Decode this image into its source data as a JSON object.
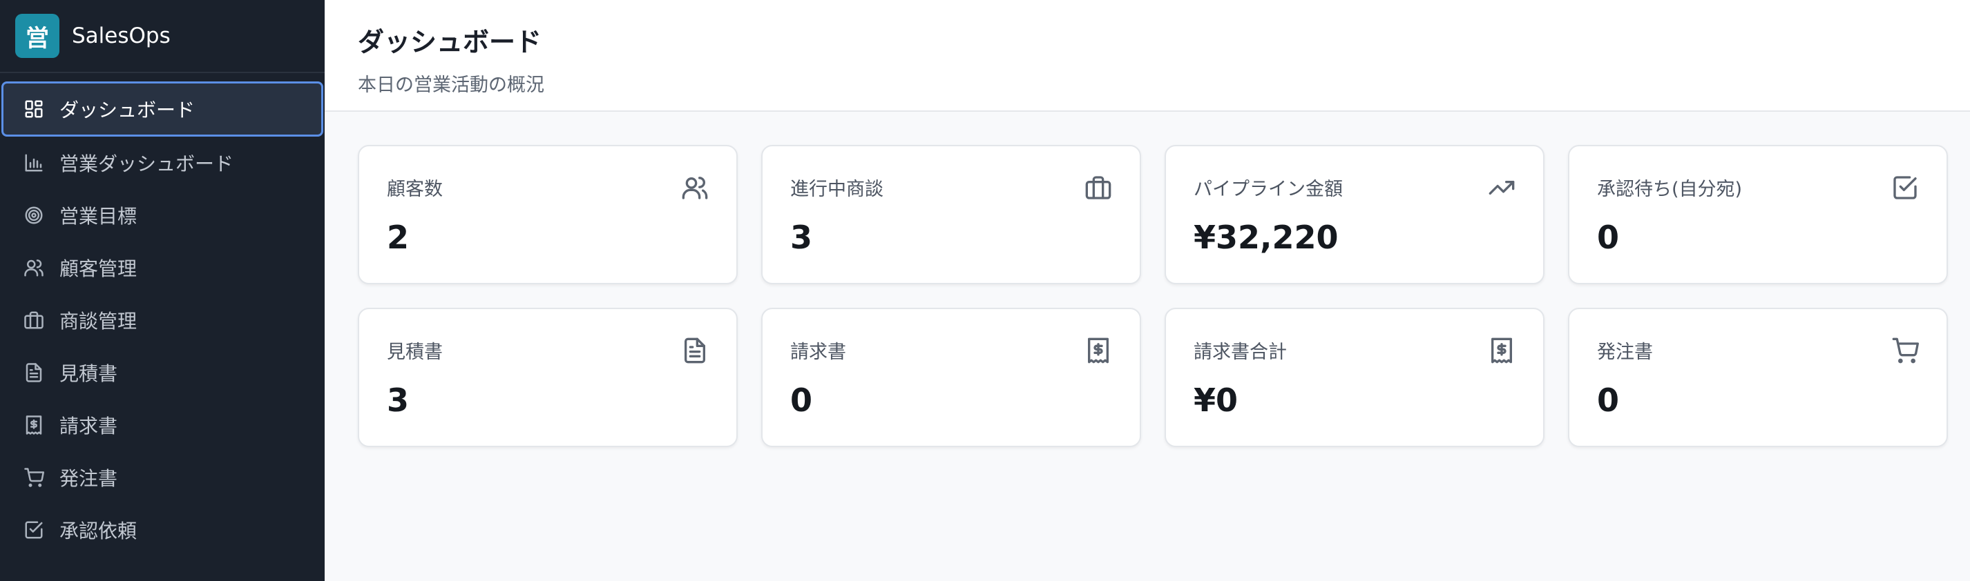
{
  "app": {
    "logo_char": "営",
    "name": "SalesOps"
  },
  "sidebar": {
    "items": [
      {
        "label": "ダッシュボード",
        "icon": "grid-icon",
        "active": true
      },
      {
        "label": "営業ダッシュボード",
        "icon": "bar-chart-icon"
      },
      {
        "label": "営業目標",
        "icon": "target-icon"
      },
      {
        "label": "顧客管理",
        "icon": "users-icon"
      },
      {
        "label": "商談管理",
        "icon": "briefcase-icon"
      },
      {
        "label": "見積書",
        "icon": "document-icon"
      },
      {
        "label": "請求書",
        "icon": "receipt-icon"
      },
      {
        "label": "発注書",
        "icon": "cart-icon"
      },
      {
        "label": "承認依頼",
        "icon": "check-square-icon"
      }
    ]
  },
  "header": {
    "title": "ダッシュボード",
    "subtitle": "本日の営業活動の概況"
  },
  "cards": [
    {
      "label": "顧客数",
      "value": "2",
      "icon": "users-icon"
    },
    {
      "label": "進行中商談",
      "value": "3",
      "icon": "briefcase-icon"
    },
    {
      "label": "パイプライン金額",
      "value": "¥32,220",
      "icon": "trending-up-icon"
    },
    {
      "label": "承認待ち(自分宛)",
      "value": "0",
      "icon": "check-square-icon"
    },
    {
      "label": "見積書",
      "value": "3",
      "icon": "document-icon"
    },
    {
      "label": "請求書",
      "value": "0",
      "icon": "receipt-icon"
    },
    {
      "label": "請求書合計",
      "value": "¥0",
      "icon": "receipt-icon"
    },
    {
      "label": "発注書",
      "value": "0",
      "icon": "cart-icon"
    }
  ],
  "colors": {
    "sidebar_bg": "#1a212c",
    "brand_accent": "#1c8ea6",
    "active_border": "#5b8fe6"
  }
}
